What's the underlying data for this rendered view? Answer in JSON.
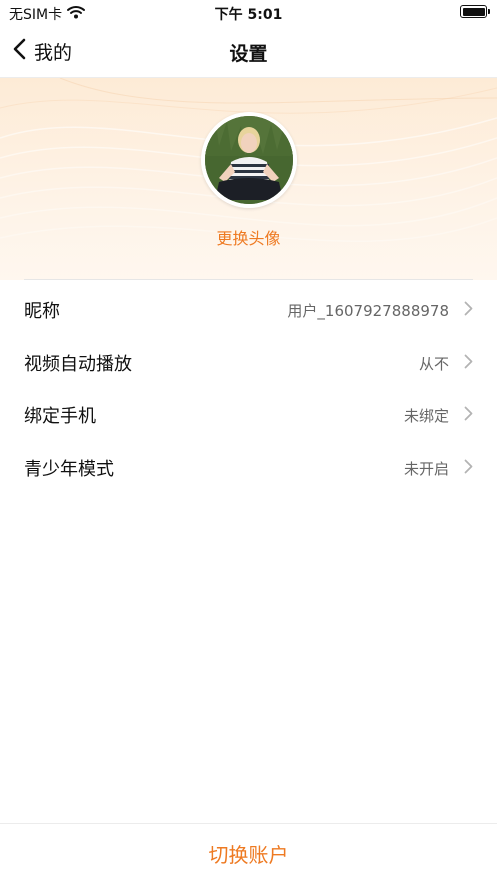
{
  "status_bar": {
    "carrier": "无SIM卡",
    "time": "下午 5:01"
  },
  "nav": {
    "back_label": "我的",
    "title": "设置"
  },
  "profile": {
    "change_avatar_label": "更换头像"
  },
  "settings": {
    "items": [
      {
        "label": "昵称",
        "value": "用户_1607927888978"
      },
      {
        "label": "视频自动播放",
        "value": "从不"
      },
      {
        "label": "绑定手机",
        "value": "未绑定"
      },
      {
        "label": "青少年模式",
        "value": "未开启"
      }
    ]
  },
  "footer": {
    "switch_account_label": "切换账户"
  },
  "colors": {
    "accent": "#ee7a22",
    "header_bg": "#fdebd6",
    "text_primary": "#111111",
    "text_secondary": "#666666"
  },
  "icons": [
    "wifi-icon",
    "battery-icon",
    "back-chevron-icon",
    "chevron-right-icon"
  ]
}
